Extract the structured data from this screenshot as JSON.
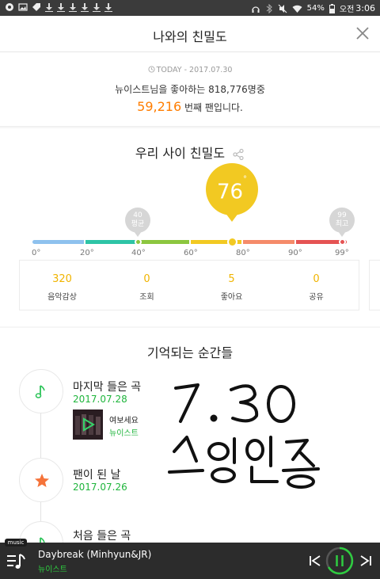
{
  "status_bar": {
    "battery": "54%",
    "ampm": "오전",
    "time": "3:06"
  },
  "header": {
    "title": "나와의 친밀도"
  },
  "today": {
    "date": "TODAY - 2017.07.30",
    "line1": "뉴이스트님을 좋아하는 818,776명중",
    "rank": "59,216",
    "rank_suffix": "번째 팬입니다."
  },
  "intimacy": {
    "title": "우리 사이 친밀도",
    "score": "76",
    "score_unit": "°",
    "score_value": 76,
    "average_marker": {
      "value": "40",
      "label": "평균"
    },
    "max_marker": {
      "value": "99",
      "label": "최고"
    },
    "ticks": [
      "0°",
      "20°",
      "40°",
      "60°",
      "80°",
      "90°",
      "99°"
    ],
    "bar_colors": [
      "#8ec1ee",
      "#2ec4a6",
      "#8cc63f",
      "#f2c922",
      "#f58b6a",
      "#e55353"
    ]
  },
  "stats": [
    {
      "value": "320",
      "label": "음악감상"
    },
    {
      "value": "0",
      "label": "조회"
    },
    {
      "value": "5",
      "label": "좋아요"
    },
    {
      "value": "0",
      "label": "공유"
    }
  ],
  "memories": {
    "title": "기억되는 순간들",
    "items": [
      {
        "label": "마지막 들은 곡",
        "date": "2017.07.28",
        "icon": "music-note-icon"
      },
      {
        "label": "팬이 된 날",
        "date": "2017.07.26",
        "icon": "star-icon"
      },
      {
        "label": "처음 들은 곡",
        "date": "",
        "icon": "music-note-icon"
      }
    ],
    "song": {
      "title": "여보세요",
      "artist": "뉴이스트"
    }
  },
  "handwriting": {
    "text": "7.30 스밍인증"
  },
  "player": {
    "tag": "music",
    "title": "Daybreak (Minhyun&JR)",
    "artist": "뉴이스트"
  },
  "colors": {
    "accent_orange": "#ff7d00",
    "accent_yellow": "#f2c922",
    "accent_green": "#1fb53c"
  }
}
